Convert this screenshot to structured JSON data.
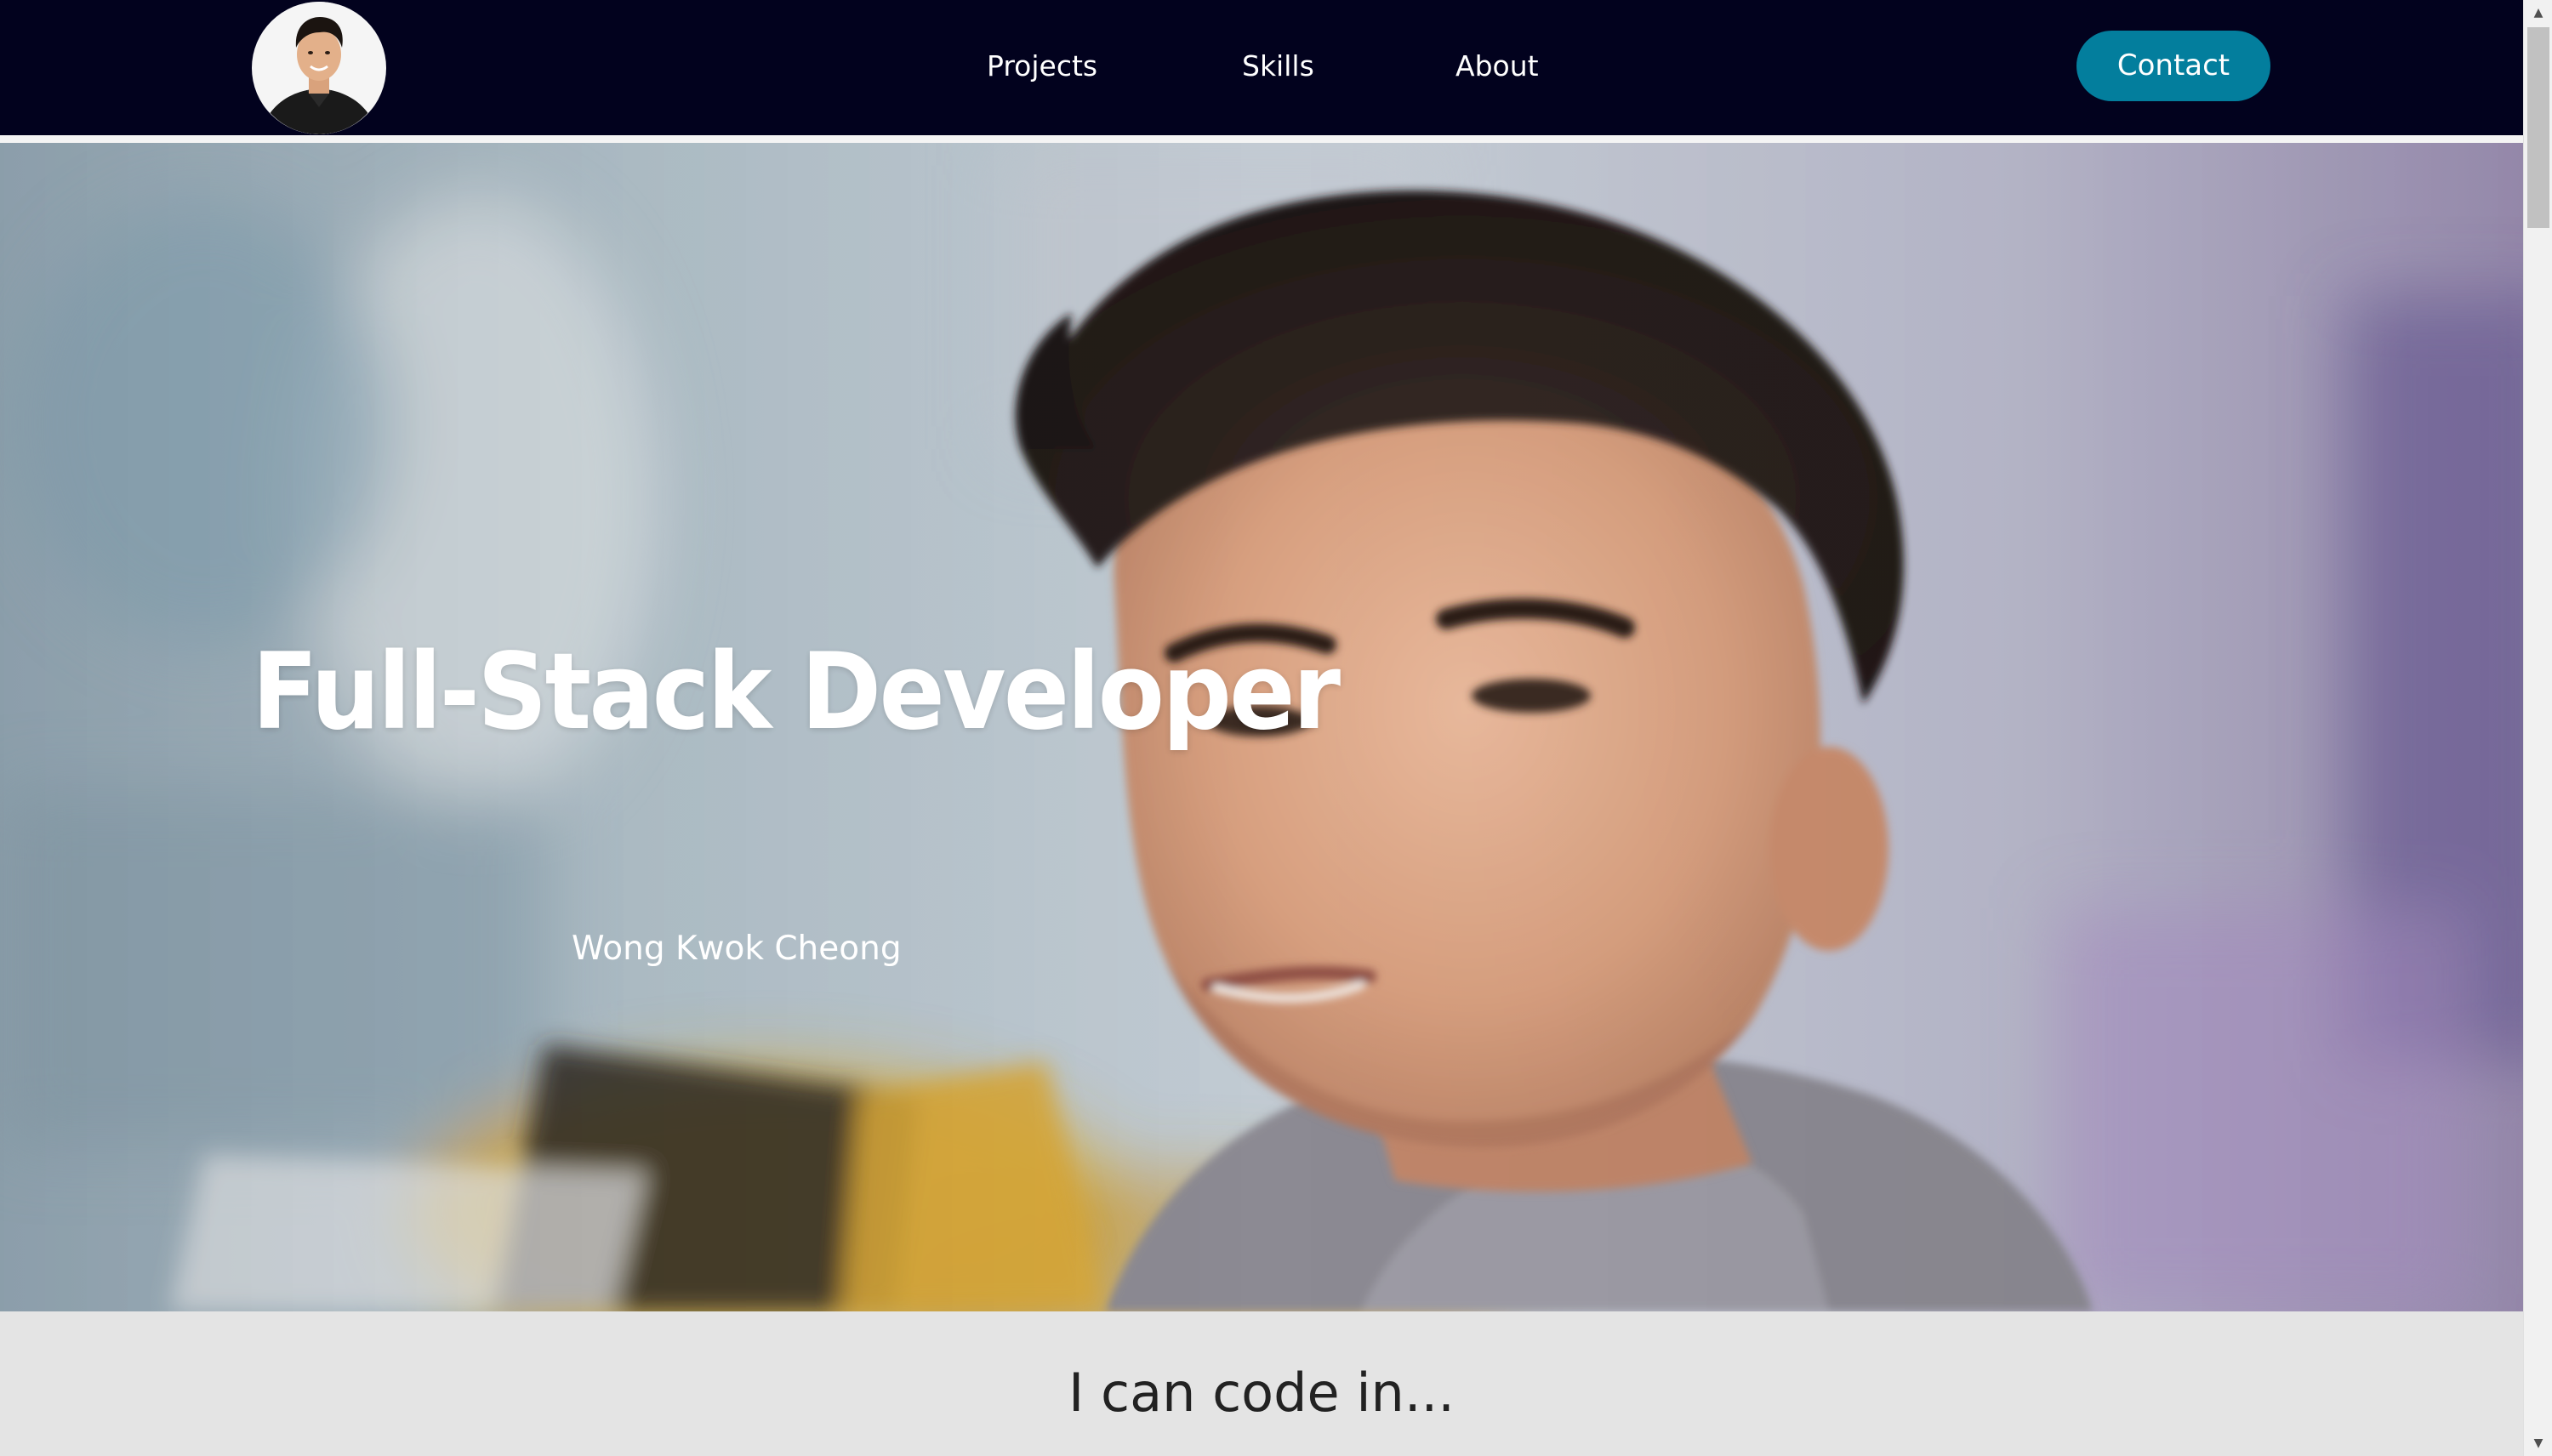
{
  "navbar": {
    "links": [
      {
        "label": "Projects"
      },
      {
        "label": "Skills"
      },
      {
        "label": "About"
      }
    ],
    "contact_label": "Contact",
    "background_color": "#02021e",
    "accent_color": "#037e9d"
  },
  "hero": {
    "title": "Full-Stack Developer",
    "subtitle": "Wong Kwok Cheong"
  },
  "skills": {
    "heading": "I can code in..."
  },
  "icons": {
    "scroll_up": "scroll-up-arrow-icon",
    "scroll_down": "scroll-down-arrow-icon"
  }
}
